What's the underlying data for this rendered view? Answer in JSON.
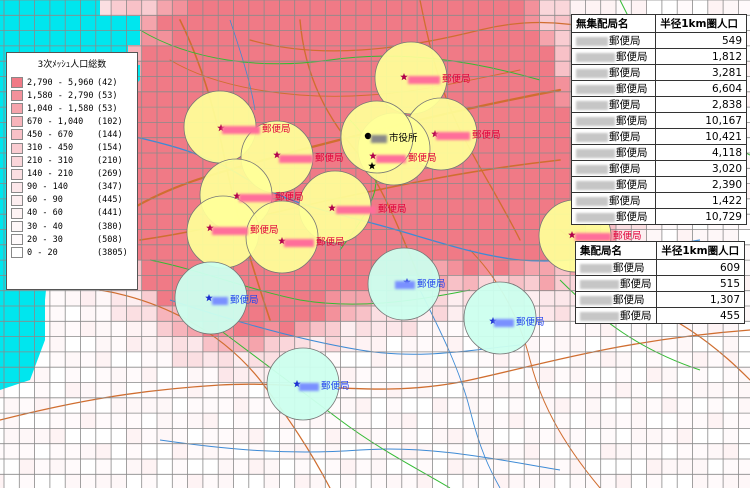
{
  "legend": {
    "title": "3次ﾒｯｼｭ人口総数",
    "rows": [
      {
        "range": "2,790 - 5,960",
        "count": "(42)",
        "color": "#f07a86"
      },
      {
        "range": "1,580 - 2,790",
        "count": "(53)",
        "color": "#f3919b"
      },
      {
        "range": "1,040 - 1,580",
        "count": "(53)",
        "color": "#f5a4ac"
      },
      {
        "range": "670 - 1,040",
        "count": "(102)",
        "color": "#f7b4bb"
      },
      {
        "range": "450 - 670",
        "count": "(144)",
        "color": "#f8c1c7"
      },
      {
        "range": "310 - 450",
        "count": "(154)",
        "color": "#f9ccd1"
      },
      {
        "range": "210 - 310",
        "count": "(210)",
        "color": "#fad6da"
      },
      {
        "range": "140 - 210",
        "count": "(269)",
        "color": "#fbdfe2"
      },
      {
        "range": "90 - 140",
        "count": "(347)",
        "color": "#fce7ea"
      },
      {
        "range": "60 - 90",
        "count": "(445)",
        "color": "#fdeef0"
      },
      {
        "range": "40 - 60",
        "count": "(441)",
        "color": "#fef3f4"
      },
      {
        "range": "30 - 40",
        "count": "(380)",
        "color": "#fef7f8"
      },
      {
        "range": "20 - 30",
        "count": "(508)",
        "color": "#fffafb"
      },
      {
        "range": "0 - 20",
        "count": "(3805)",
        "color": "#ffffff"
      }
    ]
  },
  "table_nonhub": {
    "col1": "無集配局名",
    "col2": "半径1km圏人口",
    "rows": [
      {
        "name": "郵便局",
        "value": "549"
      },
      {
        "name": "郵便局",
        "value": "1,812"
      },
      {
        "name": "郵便局",
        "value": "3,281"
      },
      {
        "name": "郵便局",
        "value": "6,604"
      },
      {
        "name": "郵便局",
        "value": "2,838"
      },
      {
        "name": "郵便局",
        "value": "10,167"
      },
      {
        "name": "郵便局",
        "value": "10,421"
      },
      {
        "name": "郵便局",
        "value": "4,118"
      },
      {
        "name": "郵便局",
        "value": "3,020"
      },
      {
        "name": "郵便局",
        "value": "2,390"
      },
      {
        "name": "郵便局",
        "value": "1,422"
      },
      {
        "name": "郵便局",
        "value": "10,729"
      }
    ]
  },
  "table_hub": {
    "col1": "集配局名",
    "col2": "半径1km圏人口",
    "rows": [
      {
        "name": "郵便局",
        "value": "609"
      },
      {
        "name": "郵便局",
        "value": "515"
      },
      {
        "name": "郵便局",
        "value": "1,307"
      },
      {
        "name": "郵便局",
        "value": "455"
      }
    ]
  },
  "map_labels": {
    "post_office": "郵便局",
    "city_office": "市役所"
  },
  "colors": {
    "sea": "#00e6ee",
    "nonhub_circle": "#ffff99",
    "hub_circle": "#ccffee",
    "nonhub_label": "#e0003a",
    "hub_label": "#2244ee",
    "grid_line": "#8a8a8a",
    "river": "#3d8bd6",
    "road": "#d06e30",
    "boundary": "#33bb33"
  }
}
